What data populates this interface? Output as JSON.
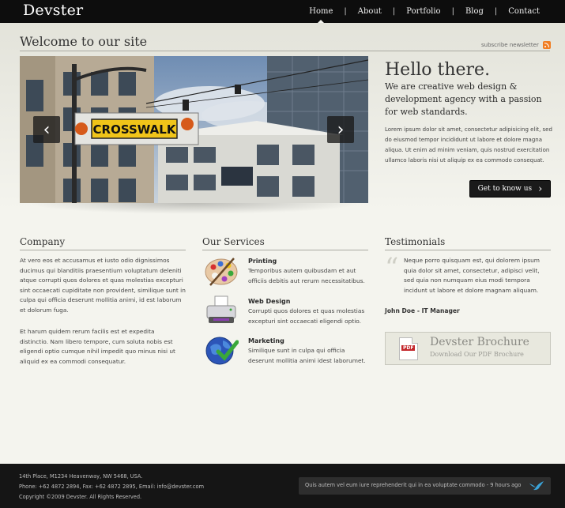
{
  "header": {
    "logo": "Devster",
    "nav": [
      {
        "label": "Home",
        "active": true
      },
      {
        "label": "About",
        "active": false
      },
      {
        "label": "Portfolio",
        "active": false
      },
      {
        "label": "Blog",
        "active": false
      },
      {
        "label": "Contact",
        "active": false
      }
    ],
    "separator": "|"
  },
  "welcome": {
    "title": "Welcome to our site",
    "subscribe": "subscribe newsletter"
  },
  "slider": {
    "sign_text": "CROSSWALK",
    "prev": "‹",
    "next": "›"
  },
  "hello": {
    "title": "Hello there.",
    "lead": "We are creative web design & development agency with a passion for web standards.",
    "body": "Lorem ipsum dolor sit amet, consectetur adipisicing elit, sed do eiusmod tempor incididunt ut labore et dolore magna aliqua. Ut enim ad minim veniam, quis nostrud exercitation ullamco laboris nisi ut aliquip ex ea commodo consequat.",
    "cta": "Get to know us",
    "cta_arrow": "›"
  },
  "company": {
    "title": "Company",
    "para1": "At vero eos et accusamus et iusto odio dignissimos ducimus qui blanditiis praesentium voluptatum deleniti atque corrupti quos dolores et quas molestias excepturi sint occaecati cupiditate non provident, similique sunt in culpa qui officia deserunt mollitia animi, id est laborum et dolorum fuga.",
    "para2": "Et harum quidem rerum facilis est et expedita distinctio. Nam libero tempore, cum soluta nobis est eligendi optio cumque nihil impedit quo minus nisi ut aliquid ex ea commodi consequatur."
  },
  "services": {
    "title": "Our Services",
    "items": [
      {
        "title": "Printing",
        "text": "Temporibus autem quibusdam et aut officiis debitis aut rerum necessitatibus.",
        "icon": "palette-icon"
      },
      {
        "title": "Web Design",
        "text": "Corrupti quos dolores et quas molestias excepturi sint occaecati eligendi optio.",
        "icon": "printer-icon"
      },
      {
        "title": "Marketing",
        "text": "Similique sunt in culpa qui officia deserunt mollitia animi idest laborumet.",
        "icon": "globe-check-icon"
      }
    ]
  },
  "testimonials": {
    "title": "Testimonials",
    "quote_mark": "“",
    "quote": "Neque porro quisquam est, qui dolorem ipsum quia dolor sit amet, consectetur, adipisci velit, sed quia non numquam eius modi tempora incidunt ut labore et dolore magnam aliquam.",
    "author": "John Doe - IT Manager"
  },
  "brochure": {
    "title": "Devster Brochure",
    "subtitle": "Download Our PDF Brochure",
    "badge": "PDF"
  },
  "footer": {
    "address": "14th Place, M1234 Heavenway, NW 5468, USA.",
    "contact": "Phone: +62 4872 2894, Fax: +62 4872 2895, Email: info@devster.com",
    "copyright": "Copyright ©2009 Devster. All Rights Reserved.",
    "tweet": "Quis autem vel eum iure reprehenderit qui in ea voluptate commodo - 9 hours ago"
  },
  "colors": {
    "header_bg": "#0d0d0d",
    "page_bg": "#f4f4ee",
    "footer_bg": "#151515",
    "rss": "#f07d22",
    "twitter": "#3aa3d9"
  }
}
